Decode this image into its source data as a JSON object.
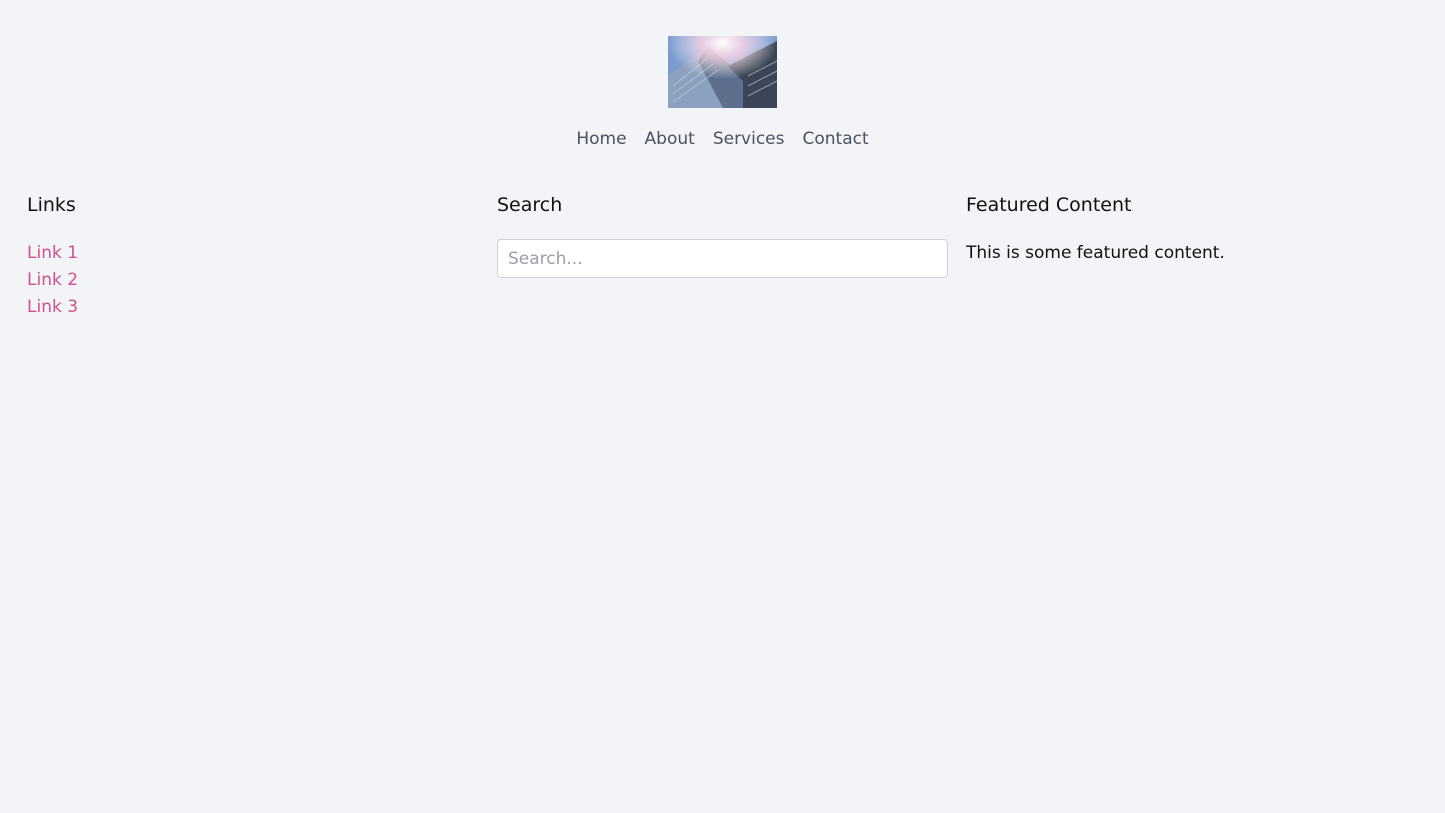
{
  "nav": {
    "items": [
      {
        "label": "Home"
      },
      {
        "label": "About"
      },
      {
        "label": "Services"
      },
      {
        "label": "Contact"
      }
    ]
  },
  "links_section": {
    "heading": "Links",
    "items": [
      {
        "label": "Link 1"
      },
      {
        "label": "Link 2"
      },
      {
        "label": "Link 3"
      }
    ]
  },
  "search_section": {
    "heading": "Search",
    "placeholder": "Search..."
  },
  "featured_section": {
    "heading": "Featured Content",
    "text": "This is some featured content."
  },
  "colors": {
    "background": "#f3f4f7",
    "link": "#d0508c",
    "nav_text": "#4a5160"
  }
}
